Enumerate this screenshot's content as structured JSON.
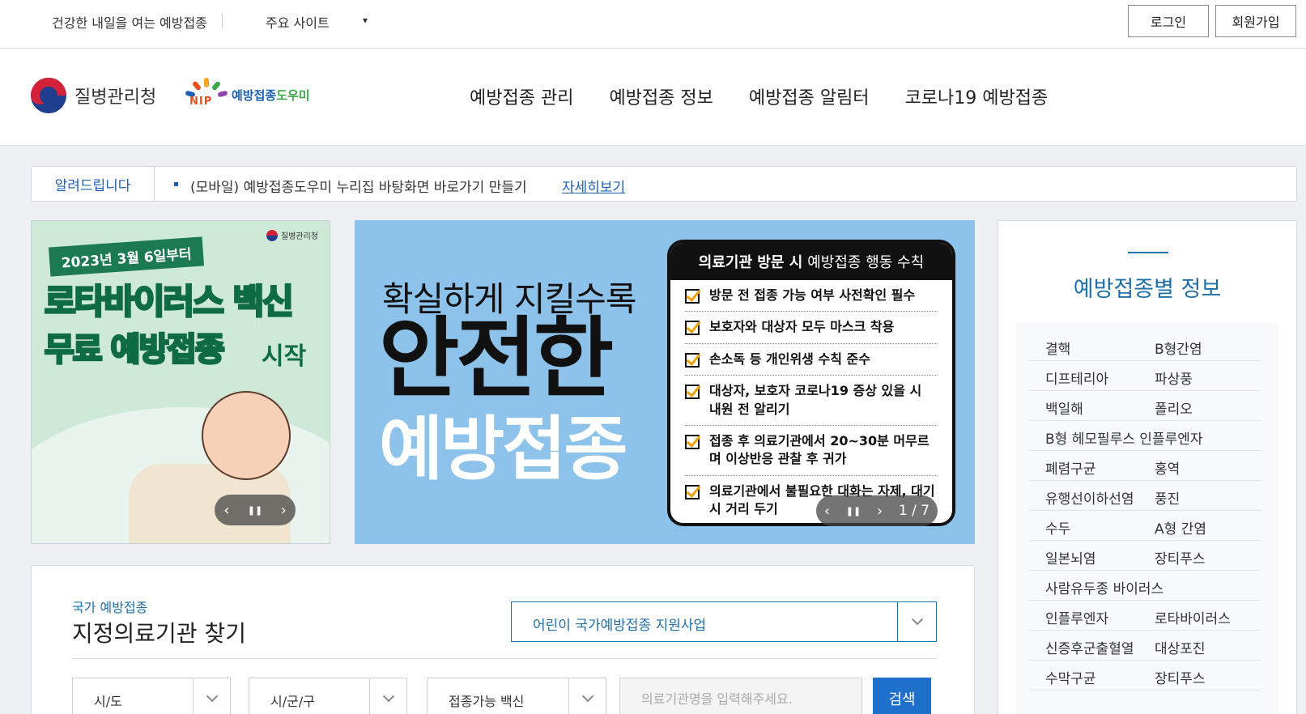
{
  "topbar": {
    "slogan": "건강한 내일을 여는 예방접종",
    "sites": "주요 사이트",
    "sites_arrow": "▾",
    "login": "로그인",
    "join": "회원가입"
  },
  "header": {
    "agency": "질병관리청",
    "nip_mark": "NIP",
    "nip_label_a": "예방접종",
    "nip_label_b": "도우미",
    "nav": [
      "예방접종 관리",
      "예방접종 정보",
      "예방접종 알림터",
      "코로나19 예방접종"
    ]
  },
  "notice": {
    "label": "알려드립니다",
    "text": "(모바일) 예방접종도우미 누리집 바탕화면 바로가기 만들기",
    "more": "자세히보기"
  },
  "banner1": {
    "agency": "질병관리청",
    "date": "2023년 3월 6일부터",
    "line1": "로타바이러스 백신",
    "line2": "무료 예방접종",
    "line3": "시작",
    "prev": "‹",
    "pause": "❚❚",
    "next": "›"
  },
  "banner2": {
    "h1": "확실하게 지킬수록",
    "h2": "안전한",
    "h3": "예방접종",
    "card_title_a": "의료기관 방문 시",
    "card_title_b": "예방접종 행동 수칙",
    "rules": [
      "방문 전 접종 가능 여부 사전확인 필수",
      "보호자와 대상자 모두 마스크 착용",
      "손소독 등 개인위생 수칙 준수",
      "대상자, 보호자 코로나19 증상 있을 시 내원 전 알리기",
      "접종 후 의료기관에서 20~30분 머무르며 이상반응 관찰 후 귀가",
      "의료기관에서 불필요한 대화는 자제, 대기 시 거리 두기"
    ],
    "prev": "‹",
    "pause": "❚❚",
    "next": "›",
    "pager": "1 / 7"
  },
  "vaccine_panel": {
    "title": "예방접종별 정보",
    "rows": [
      [
        "결핵",
        "B형간염"
      ],
      [
        "디프테리아",
        "파상풍"
      ],
      [
        "백일해",
        "폴리오"
      ],
      [
        "B형 헤모필루스 인플루엔자",
        ""
      ],
      [
        "폐렴구균",
        "홍역"
      ],
      [
        "유행선이하선염",
        "풍진"
      ],
      [
        "수두",
        "A형 간염"
      ],
      [
        "일본뇌염",
        "장티푸스"
      ],
      [
        "사람유두종 바이러스",
        ""
      ],
      [
        "인플루엔자",
        "로타바이러스"
      ],
      [
        "신증후군출혈열",
        "대상포진"
      ],
      [
        "수막구균",
        "장티푸스"
      ]
    ]
  },
  "search": {
    "sub": "국가 예방접종",
    "title": "지정의료기관 찾기",
    "program": "어린이 국가예방접종 지원사업",
    "sido": "시/도",
    "sigungu": "시/군/구",
    "vaccine": "접종가능 백신",
    "placeholder": "의료기관명을 입력해주세요.",
    "button": "검색"
  }
}
